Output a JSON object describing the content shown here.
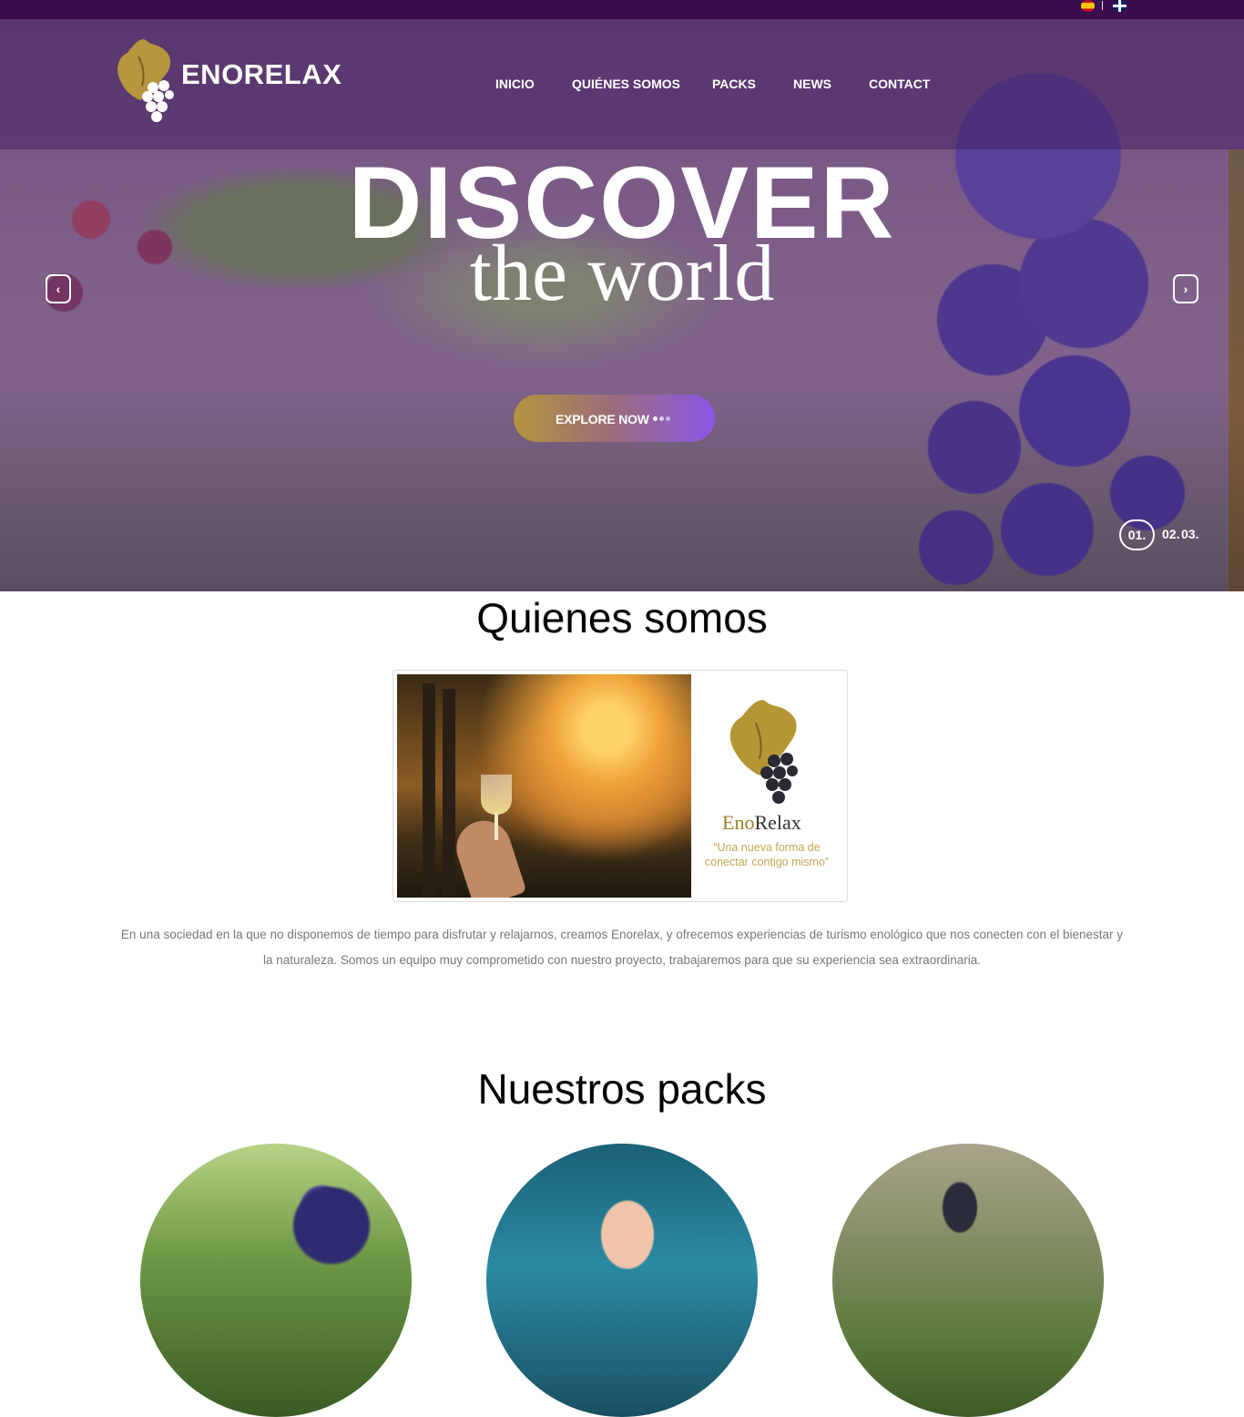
{
  "header": {
    "brand": "ENORELAX",
    "languages": [
      "es-flag-icon",
      "uk-flag-icon"
    ],
    "nav": [
      "INICIO",
      "QUIÉNES SOMOS",
      "PACKS",
      "NEWS",
      "CONTACT"
    ]
  },
  "hero": {
    "headline": "DISCOVER",
    "subheadline": "the world",
    "cta_label": "EXPLORE NOW",
    "slides": [
      "01.",
      "02.",
      "03."
    ],
    "active_slide": "01.",
    "prev_icon": "chevron-left-icon",
    "next_icon": "chevron-right-icon"
  },
  "about": {
    "title": "Quienes somos",
    "card_brand_a": "Eno",
    "card_brand_b": "Relax",
    "card_slogan": "“Una nueva forma de conectar contigo mismo”",
    "paragraph": "En una sociedad en la que no disponemos de tiempo para disfrutar y relajarnos, creamos Enorelax, y ofrecemos experiencias de turismo enológico que nos conecten con el bienestar y la naturaleza. Somos un equipo muy comprometido con nuestro proyecto, trabajaremos para que su experiencia sea extraordinaria."
  },
  "packs": {
    "title": "Nuestros packs"
  },
  "colors": {
    "topbar": "#3a0d4f",
    "gold": "#b4943f",
    "purple": "#8b56e8",
    "text_gray": "#777777"
  }
}
